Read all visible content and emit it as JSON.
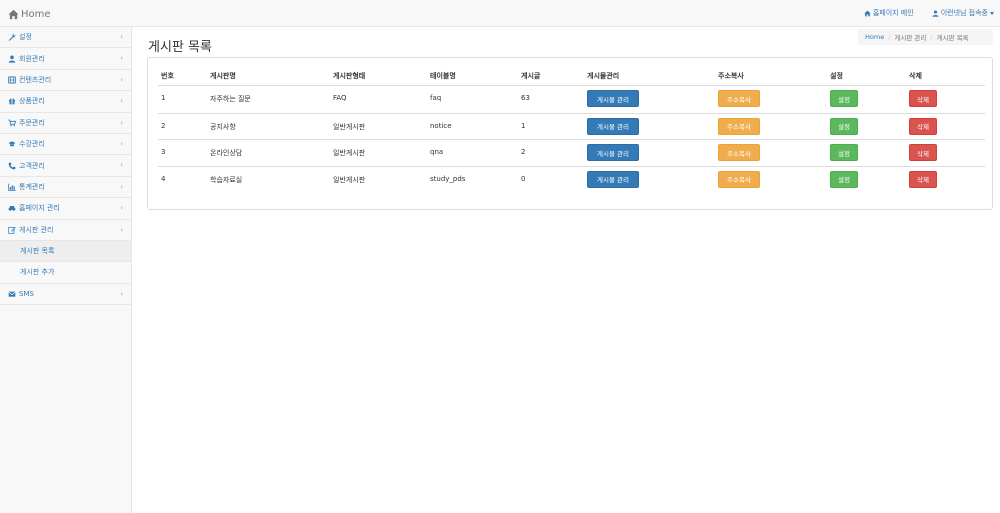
{
  "brand": {
    "label": "Home",
    "icon": "home-icon"
  },
  "top_nav": {
    "homepage_main": "홈페이지 메인",
    "user_label": "이런넷님 접속중"
  },
  "sidebar": {
    "items": [
      {
        "label": "설정",
        "icon": "wrench-icon"
      },
      {
        "label": "회원관리",
        "icon": "user-icon"
      },
      {
        "label": "컨텐츠관리",
        "icon": "film-icon"
      },
      {
        "label": "상품관리",
        "icon": "gift-icon"
      },
      {
        "label": "주문관리",
        "icon": "cart-icon"
      },
      {
        "label": "수강관리",
        "icon": "graduation-cap-icon"
      },
      {
        "label": "고객관리",
        "icon": "phone-icon"
      },
      {
        "label": "통계관리",
        "icon": "bar-chart-icon"
      },
      {
        "label": "홈페이지 관리",
        "icon": "car-icon"
      },
      {
        "label": "게시판 관리",
        "icon": "edit-icon"
      }
    ],
    "sub_items": [
      {
        "label": "게시판 목록"
      },
      {
        "label": "게시판 추가"
      }
    ],
    "sms": {
      "label": "SMS",
      "icon": "envelope-icon"
    },
    "chevron": "‹"
  },
  "page": {
    "title": "게시판 목록",
    "breadcrumb": {
      "home": "Home",
      "parent": "게시판 관리",
      "current": "게시판 목록"
    }
  },
  "table": {
    "headers": [
      "번호",
      "게시판명",
      "게시판형태",
      "테이블명",
      "게시글",
      "게시물관리",
      "주소복사",
      "설정",
      "삭제"
    ],
    "rows": [
      {
        "no": "1",
        "name": "자주하는 질문",
        "type": "FAQ",
        "table": "faq",
        "count": "63"
      },
      {
        "no": "2",
        "name": "공지사항",
        "type": "일반게시판",
        "table": "notice",
        "count": "1"
      },
      {
        "no": "3",
        "name": "온라인상담",
        "type": "일반게시판",
        "table": "qna",
        "count": "2"
      },
      {
        "no": "4",
        "name": "학습자료실",
        "type": "일반게시판",
        "table": "study_pds",
        "count": "0"
      }
    ],
    "buttons": {
      "manage": "게시물 관리",
      "copy": "주소복사",
      "settings": "설정",
      "delete": "삭제"
    }
  },
  "colors": {
    "primary": "#337ab7",
    "warning": "#f0ad4e",
    "success": "#5cb85c",
    "danger": "#d9534f"
  }
}
